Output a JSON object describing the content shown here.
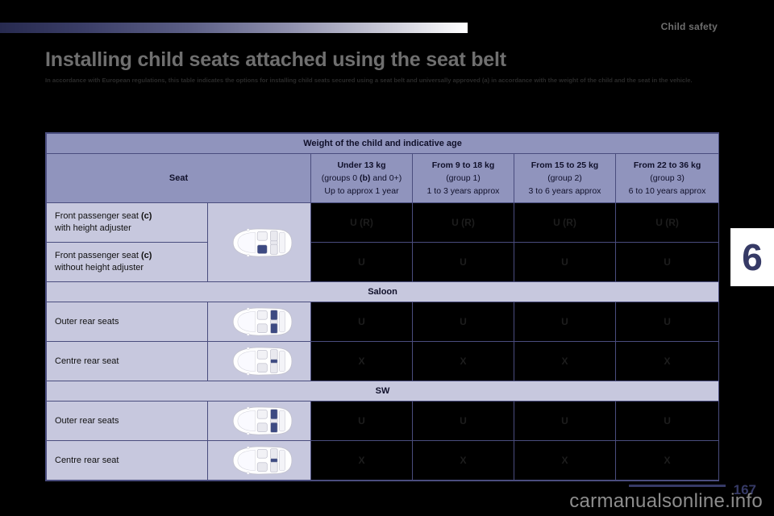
{
  "header": {
    "section_label": "Child safety"
  },
  "title": "Installing child seats attached using the seat belt",
  "subtitle": "In accordance with European regulations, this table indicates the options for installing child seats secured using a seat belt and universally approved (a) in accordance with the weight of the child and the seat in the vehicle.",
  "side_tab": {
    "number": "6"
  },
  "footer": {
    "page_number": "167",
    "watermark": "carmanualsonline.info"
  },
  "colors": {
    "header_band": "#9094bd",
    "row_band": "#c7c8de",
    "border": "#4a4d7e",
    "accent": "#363a66",
    "symbol_cell_bg": "#000000",
    "title_gray": "#6f6f6f"
  },
  "table": {
    "top_header": "Weight of the child and indicative age",
    "seat_column_header": "Seat",
    "group_columns": [
      {
        "weight": "Under 13 kg",
        "group": "(groups 0 (b) and 0+)",
        "age": "Up to approx 1 year"
      },
      {
        "weight": "From 9 to 18 kg",
        "group": "(group 1)",
        "age": "1 to 3 years approx"
      },
      {
        "weight": "From 15 to 25 kg",
        "group": "(group 2)",
        "age": "3 to 6 years approx"
      },
      {
        "weight": "From 22 to 36 kg",
        "group": "(group 3)",
        "age": "6 to 10 years approx"
      }
    ],
    "rows": [
      {
        "kind": "seat",
        "label_line1": "Front passenger seat (c)",
        "label_line2": "with height adjuster",
        "diagram": "car-front-seat-highlight",
        "values": [
          "U (R)",
          "U (R)",
          "U (R)",
          "U (R)"
        ]
      },
      {
        "kind": "seat",
        "label_line1": "Front passenger seat (c)",
        "label_line2": "without height adjuster",
        "diagram": "",
        "values": [
          "U",
          "U",
          "U",
          "U"
        ]
      },
      {
        "kind": "section",
        "label": "Saloon"
      },
      {
        "kind": "seat",
        "label_line1": "Outer rear seats",
        "label_line2": "",
        "diagram": "car-outer-rear-highlight",
        "values": [
          "U",
          "U",
          "U",
          "U"
        ]
      },
      {
        "kind": "seat",
        "label_line1": "Centre rear seat",
        "label_line2": "",
        "diagram": "car-centre-rear-highlight",
        "values": [
          "X",
          "X",
          "X",
          "X"
        ]
      },
      {
        "kind": "section",
        "label": "SW"
      },
      {
        "kind": "seat",
        "label_line1": "Outer rear seats",
        "label_line2": "",
        "diagram": "car-outer-rear-highlight",
        "values": [
          "U",
          "U",
          "U",
          "U"
        ]
      },
      {
        "kind": "seat",
        "label_line1": "Centre rear seat",
        "label_line2": "",
        "diagram": "car-centre-rear-highlight",
        "values": [
          "X",
          "X",
          "X",
          "X"
        ]
      }
    ]
  }
}
